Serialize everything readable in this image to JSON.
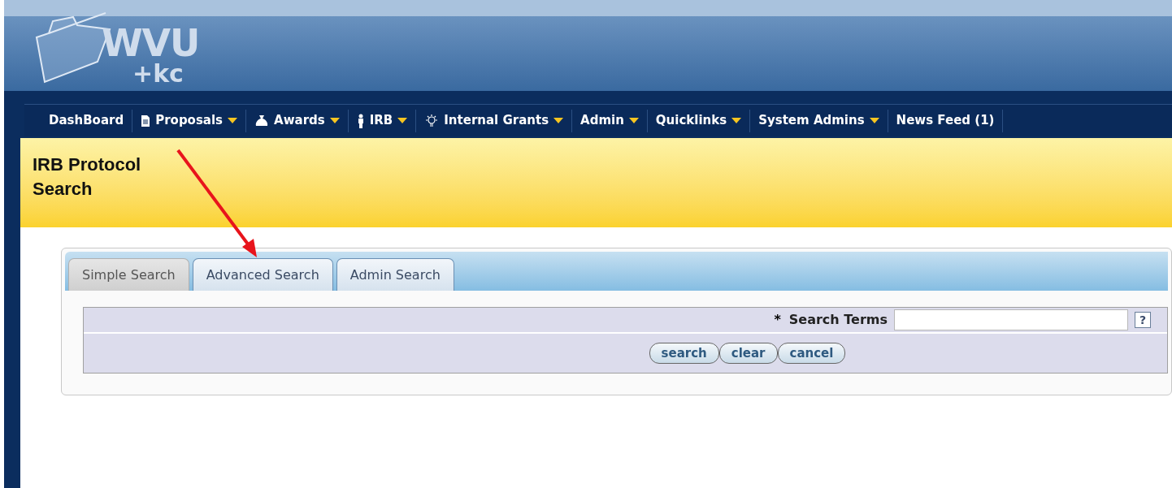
{
  "logo": {
    "lines": [
      "WVU",
      "+kc"
    ]
  },
  "nav": [
    {
      "label": "DashBoard",
      "kind": "plain",
      "dropdown": false
    },
    {
      "label": "Proposals",
      "kind": "document",
      "dropdown": true
    },
    {
      "label": "Awards",
      "kind": "money",
      "dropdown": true
    },
    {
      "label": "IRB",
      "kind": "person",
      "dropdown": true
    },
    {
      "label": "Internal Grants",
      "kind": "bulb",
      "dropdown": true
    },
    {
      "label": "Admin",
      "kind": "plain",
      "dropdown": true
    },
    {
      "label": "Quicklinks",
      "kind": "plain",
      "dropdown": true
    },
    {
      "label": "System Admins",
      "kind": "plain",
      "dropdown": true
    },
    {
      "label": "News Feed (1)",
      "kind": "plain",
      "dropdown": false
    }
  ],
  "page_title": "IRB Protocol Search",
  "tabs": [
    {
      "label": "Simple Search",
      "selected": true
    },
    {
      "label": "Advanced Search",
      "selected": false
    },
    {
      "label": "Admin Search",
      "selected": false
    }
  ],
  "search_form": {
    "required_mark": "*",
    "label": "Search Terms",
    "help": "?",
    "buttons": [
      "search",
      "clear",
      "cancel"
    ]
  }
}
